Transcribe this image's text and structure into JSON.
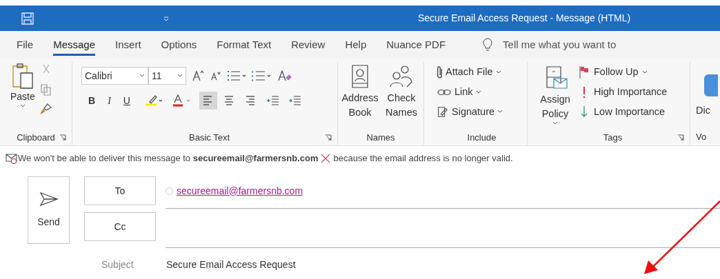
{
  "window": {
    "title": "Secure Email Access Request  -  Message (HTML)"
  },
  "tabs": [
    {
      "label": "File",
      "selected": false
    },
    {
      "label": "Message",
      "selected": true
    },
    {
      "label": "Insert",
      "selected": false
    },
    {
      "label": "Options",
      "selected": false
    },
    {
      "label": "Format Text",
      "selected": false
    },
    {
      "label": "Review",
      "selected": false
    },
    {
      "label": "Help",
      "selected": false
    },
    {
      "label": "Nuance PDF",
      "selected": false
    }
  ],
  "tell_me": {
    "placeholder": "Tell me what you want to"
  },
  "ribbon": {
    "clipboard": {
      "label": "Clipboard",
      "paste": "Paste"
    },
    "basic_text": {
      "label": "Basic Text",
      "font": "Calibri",
      "size": "11",
      "bold": "B",
      "italic": "I",
      "underline": "U",
      "alignments": [
        {
          "kind": "left",
          "selected": true
        },
        {
          "kind": "center",
          "selected": false
        },
        {
          "kind": "right",
          "selected": false
        }
      ]
    },
    "names": {
      "label": "Names",
      "buttons": [
        "Address Book",
        "Check Names"
      ]
    },
    "include": {
      "label": "Include",
      "items": [
        {
          "kind": "attach",
          "label": "Attach File"
        },
        {
          "kind": "link",
          "label": "Link"
        },
        {
          "kind": "signature",
          "label": "Signature"
        }
      ]
    },
    "tags": {
      "label": "Tags",
      "assign": "Assign Policy",
      "items": [
        {
          "kind": "flag",
          "label": "Follow Up"
        },
        {
          "kind": "high",
          "label": "High Importance"
        },
        {
          "kind": "low",
          "label": "Low Importance"
        }
      ]
    },
    "voice": {
      "label": "Vo",
      "button": "Dic"
    }
  },
  "info_bar": {
    "text": "We won't be able to deliver this message to **secureemail@farmersnb.com**",
    "suffix": "because the email address is no longer valid."
  },
  "compose": {
    "send": "Send",
    "to": {
      "label": "To",
      "recipients": [
        "secureemail@farmersnb.com"
      ]
    },
    "cc": {
      "label": "Cc"
    },
    "subject": {
      "label": "Subject",
      "value": "Secure Email Access Request"
    }
  }
}
